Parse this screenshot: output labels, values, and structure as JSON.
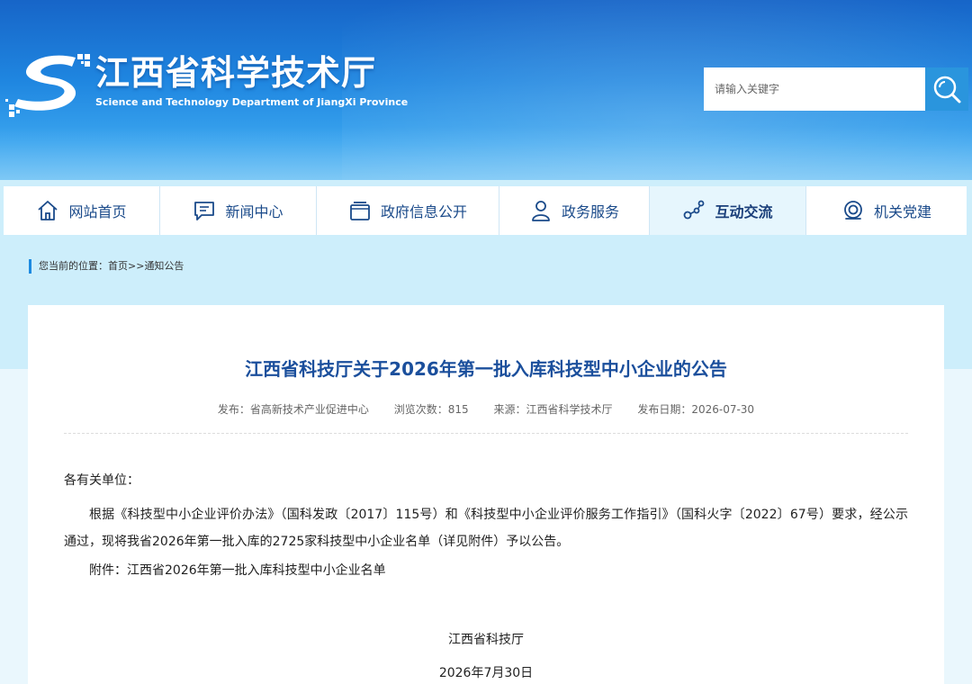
{
  "header": {
    "org_name_cn": "江西省科学技术厅",
    "org_name_en": "Science and Technology Department of JiangXi Province",
    "search": {
      "placeholder": "请输入关键字"
    },
    "brand_color": "#1f86e0"
  },
  "nav": {
    "items": [
      {
        "label": "网站首页",
        "icon": "home-icon"
      },
      {
        "label": "新闻中心",
        "icon": "chat-icon"
      },
      {
        "label": "政府信息公开",
        "icon": "folder-icon"
      },
      {
        "label": "政务服务",
        "icon": "user-icon"
      },
      {
        "label": "互动交流",
        "icon": "network-icon",
        "active": true
      },
      {
        "label": "机关党建",
        "icon": "badge-icon"
      }
    ]
  },
  "breadcrumb": {
    "prefix": "您当前的位置：",
    "home": "首页",
    "separator": ">>",
    "current": "通知公告"
  },
  "article": {
    "title": "江西省科技厅关于2026年第一批入库科技型中小企业的公告",
    "meta": {
      "publisher": "发布：省高新技术产业促进中心",
      "views": "浏览次数：815",
      "source": "来源：江西省科学技术厅",
      "date": "发布日期：2026-07-30"
    },
    "salutation": "各有关单位：",
    "paragraph": "根据《科技型中小企业评价办法》（国科发政〔2017〕115号）和《科技型中小企业评价服务工作指引》（国科火字〔2022〕67号）要求，经公示通过，现将我省2026年第一批入库的2725家科技型中小企业名单（详见附件）予以公告。",
    "attachment": "附件：江西省2026年第一批入库科技型中小企业名单",
    "signature": "江西省科技厅",
    "signature_date": "2026年7月30日"
  }
}
